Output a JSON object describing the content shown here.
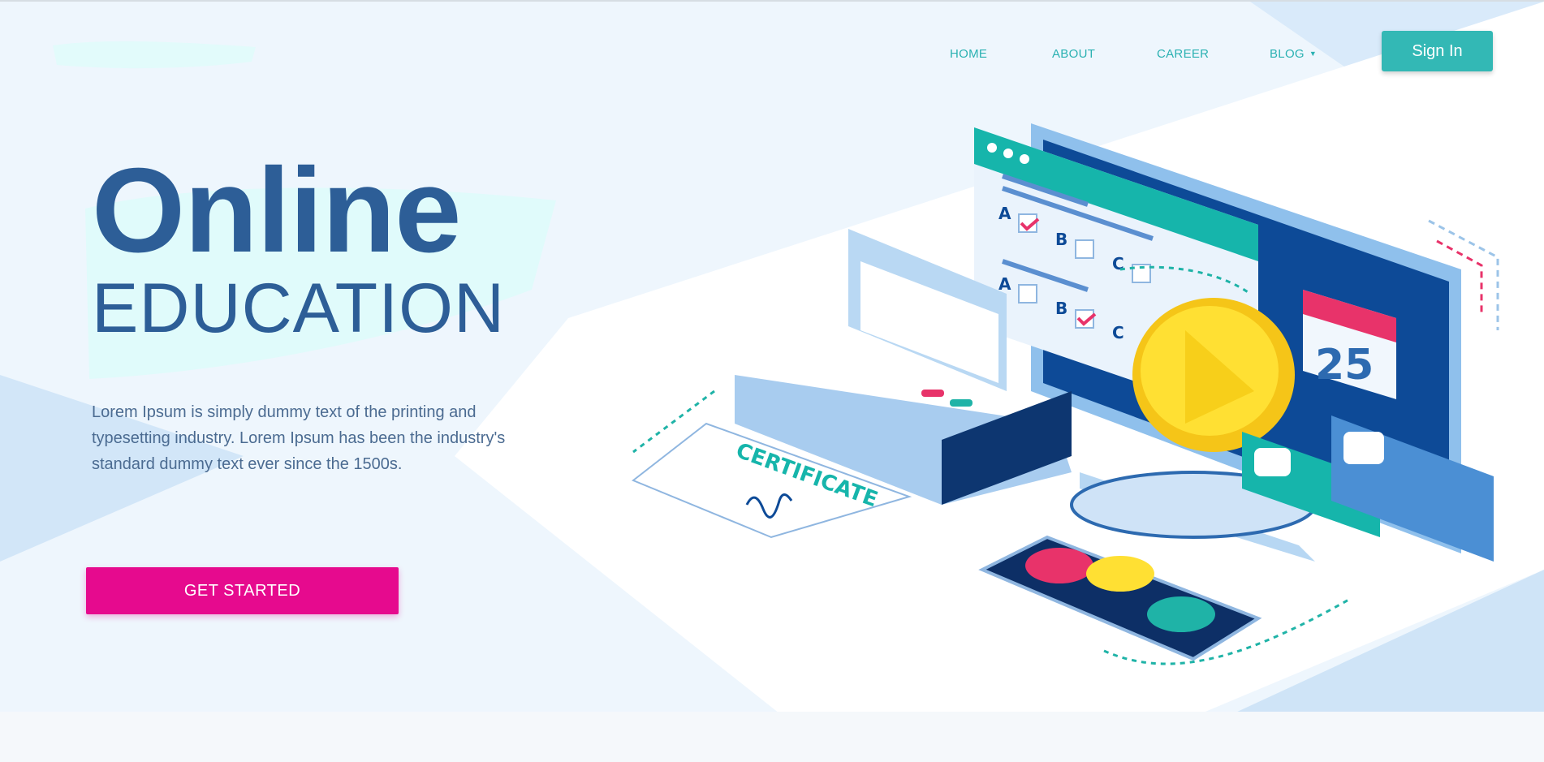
{
  "nav": {
    "items": [
      {
        "label": "HOME",
        "has_caret": false
      },
      {
        "label": "ABOUT",
        "has_caret": false
      },
      {
        "label": "CAREER",
        "has_caret": false
      },
      {
        "label": "BLOG",
        "has_caret": true
      }
    ],
    "signin_label": "Sign In"
  },
  "hero": {
    "title_line1": "Online",
    "title_line2": "EDUCATION",
    "lead": "Lorem Ipsum is simply dummy text of the printing and typesetting industry. Lorem Ipsum has been the industry's standard dummy text ever since the 1500s.",
    "cta_label": "GET STARTED"
  },
  "illustration": {
    "certificate_text": "CERTIFICATE",
    "calendar_day": "25",
    "quiz_options": [
      "A",
      "B",
      "C",
      "A",
      "B",
      "C"
    ]
  },
  "colors": {
    "accent": "#33b8b5",
    "title": "#2d5e97",
    "cta": "#e60a8e",
    "nav": "#2ab1b2",
    "background": "#eef6fd"
  }
}
